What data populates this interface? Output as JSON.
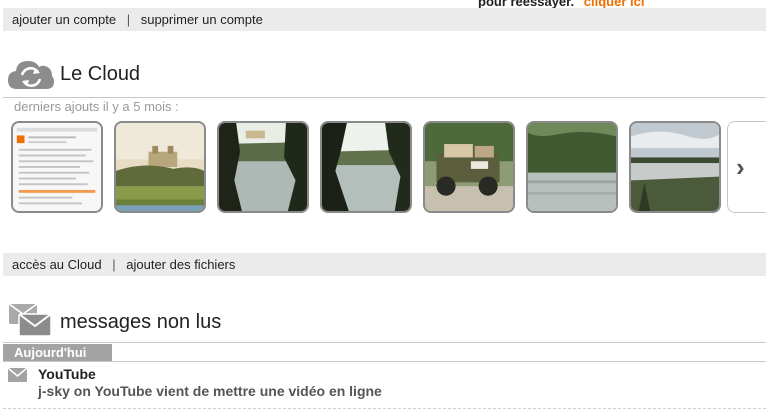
{
  "top": {
    "retry_text": "pour réessayer.",
    "retry_link": "cliquer ici"
  },
  "account_bar": {
    "add_account": "ajouter un compte",
    "separator": "|",
    "remove_account": "supprimer un compte"
  },
  "cloud": {
    "title": "Le Cloud",
    "subcaption": "derniers ajouts il y a 5 mois :",
    "thumbnails": [
      {
        "kind": "document"
      },
      {
        "kind": "castle-landscape"
      },
      {
        "kind": "lake-trees"
      },
      {
        "kind": "lake-trees"
      },
      {
        "kind": "jeep"
      },
      {
        "kind": "river"
      },
      {
        "kind": "lake-sky"
      }
    ],
    "next_glyph": "›"
  },
  "cloud_bar": {
    "access": "accès au Cloud",
    "separator": "|",
    "add_files": "ajouter des fichiers"
  },
  "messages": {
    "title": "messages non lus",
    "day_label": "Aujourd'hui",
    "items": [
      {
        "sender": "YouTube",
        "subject": "j-sky on YouTube vient de mettre une vidéo en ligne",
        "icon": "envelope-icon"
      }
    ]
  },
  "colors": {
    "accent": "#f16e00",
    "bar_bg": "#ebebeb",
    "tab_bg": "#a3a3a3",
    "icon_gray": "#8c8c8c"
  }
}
